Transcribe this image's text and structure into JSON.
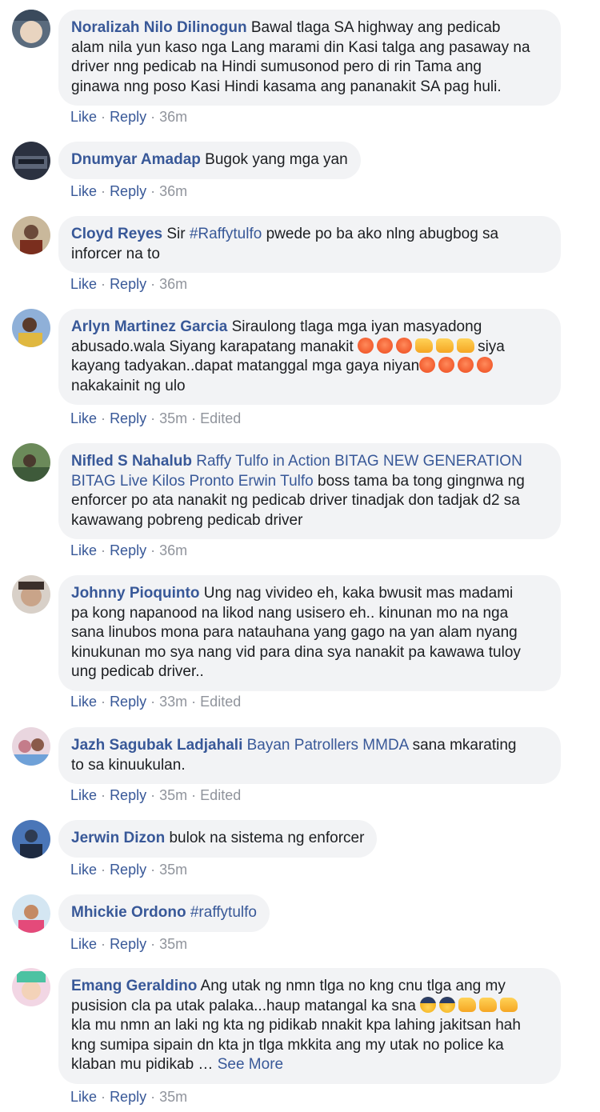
{
  "comments": [
    {
      "author": "Noralizah Nilo Dilinogun",
      "lines": [
        {
          "text": "Bawal tlaga SA highway ang pedicab"
        },
        {
          "text": "alam nila yun kaso nga Lang marami din Kasi talga ang pasaway na"
        },
        {
          "text": "driver nng pedicab na Hindi sumusonod pero di rin Tama ang"
        },
        {
          "text": "ginawa nng poso Kasi Hindi kasama ang pananakit SA pag huli."
        }
      ],
      "like": "Like",
      "reply": "Reply",
      "time": "36m",
      "edited": ""
    },
    {
      "author": "Dnumyar Amadap",
      "lines": [
        {
          "text": "Bugok yang mga yan"
        }
      ],
      "like": "Like",
      "reply": "Reply",
      "time": "36m",
      "edited": ""
    },
    {
      "author": "Cloyd Reyes",
      "lines": [
        {
          "text": "Sir ",
          "tag": "#Raffytulfo",
          "rest": " pwede po ba ako nlng abugbog sa"
        },
        {
          "text": "inforcer na to"
        }
      ],
      "like": "Like",
      "reply": "Reply",
      "time": "36m",
      "edited": ""
    },
    {
      "author": "Arlyn Martinez Garcia",
      "lines": [
        {
          "text": "Siraulong tlaga mga iyan masyadong"
        },
        {
          "text": "abusado.wala Siyang karapatang manakit",
          "after": "siya"
        },
        {
          "text": "kayang tadyakan..dapat matanggal mga gaya niyan"
        },
        {
          "text": "nakakainit ng ulo"
        }
      ],
      "like": "Like",
      "reply": "Reply",
      "time": "35m",
      "edited": "Edited"
    },
    {
      "author": "Nifled S Nahalub",
      "tags": "Raffy Tulfo in Action BITAG NEW GENERATION",
      "tags2": "BITAG Live Kilos Pronto Erwin Tulfo",
      "lines": [
        {
          "text": " boss tama ba tong gingnwa ng"
        },
        {
          "text": "enforcer po ata nanakit ng pedicab driver tinadjak don tadjak d2 sa"
        },
        {
          "text": "kawawang pobreng pedicab driver"
        }
      ],
      "like": "Like",
      "reply": "Reply",
      "time": "36m",
      "edited": ""
    },
    {
      "author": "Johnny Pioquinto",
      "lines": [
        {
          "text": "Ung nag vivideo eh, kaka bwusit mas madami"
        },
        {
          "text": "pa kong napanood na likod nang usisero eh.. kinunan mo na nga"
        },
        {
          "text": "sana linubos mona para natauhana yang gago na yan alam nyang"
        },
        {
          "text": "kinukunan mo sya nang vid para dina sya nanakit pa kawawa tuloy"
        },
        {
          "text": "ung pedicab driver.."
        }
      ],
      "like": "Like",
      "reply": "Reply",
      "time": "33m",
      "edited": "Edited"
    },
    {
      "author": "Jazh Sagubak Ladjahali",
      "tags": "Bayan Patrollers MMDA",
      "lines": [
        {
          "text": " sana mkarating"
        },
        {
          "text": "to sa kinuukulan."
        }
      ],
      "like": "Like",
      "reply": "Reply",
      "time": "35m",
      "edited": "Edited"
    },
    {
      "author": "Jerwin Dizon",
      "lines": [
        {
          "text": "bulok na sistema ng enforcer"
        }
      ],
      "like": "Like",
      "reply": "Reply",
      "time": "35m",
      "edited": ""
    },
    {
      "author": "Mhickie Ordono",
      "tags": "#raffytulfo",
      "lines": [],
      "like": "Like",
      "reply": "Reply",
      "time": "35m",
      "edited": ""
    },
    {
      "author": "Emang Geraldino",
      "lines": [
        {
          "text": "Ang utak ng nmn tlga no kng cnu tlga ang my"
        },
        {
          "text": "pusision cla pa utak palaka...haup matangal ka sna"
        },
        {
          "text": "kla mu nmn an laki ng kta ng pidikab nnakit kpa lahing jakitsan hah"
        },
        {
          "text": "kng sumipa sipain dn kta jn tlga mkkita ang my utak no police ka"
        },
        {
          "text": "klaban mu pidikab … "
        }
      ],
      "see_more": "See More",
      "like": "Like",
      "reply": "Reply",
      "time": "35m",
      "edited": ""
    }
  ],
  "separator": "·",
  "icons": {
    "angry": "angry-face-emoji",
    "fist": "oncoming-fist-emoji",
    "police": "police-officer-emoji"
  },
  "colors": {
    "link": "#385898",
    "meta": "#90949c",
    "bubble": "#f2f3f5"
  }
}
